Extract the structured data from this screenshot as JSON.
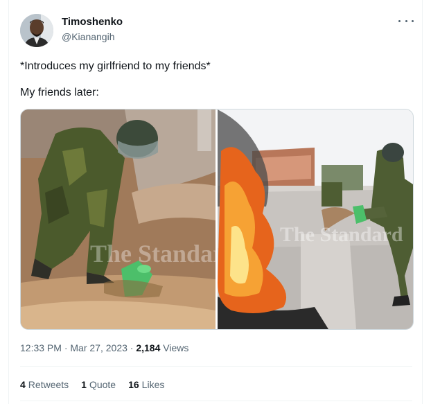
{
  "author": {
    "name": "Timoshenko",
    "handle": "@Kianangih"
  },
  "tweet": {
    "line1": "*Introduces my girlfriend to my friends*",
    "line2": "My friends later:"
  },
  "media": {
    "watermark_left": "The Standard",
    "watermark_right": "The Standard"
  },
  "meta": {
    "time": "12:33 PM",
    "sep1": " · ",
    "date": "Mar 27, 2023",
    "sep2": " · ",
    "views_count": "2,184",
    "views_label": " Views"
  },
  "stats": {
    "retweets_count": "4",
    "retweets_label": "Retweets",
    "quotes_count": "1",
    "quotes_label": "Quote",
    "likes_count": "16",
    "likes_label": "Likes"
  },
  "colors": {
    "text": "#0f1419",
    "secondary": "#536471",
    "border": "#eff3f4"
  },
  "icons": {
    "more": "more-horizontal-icon"
  }
}
